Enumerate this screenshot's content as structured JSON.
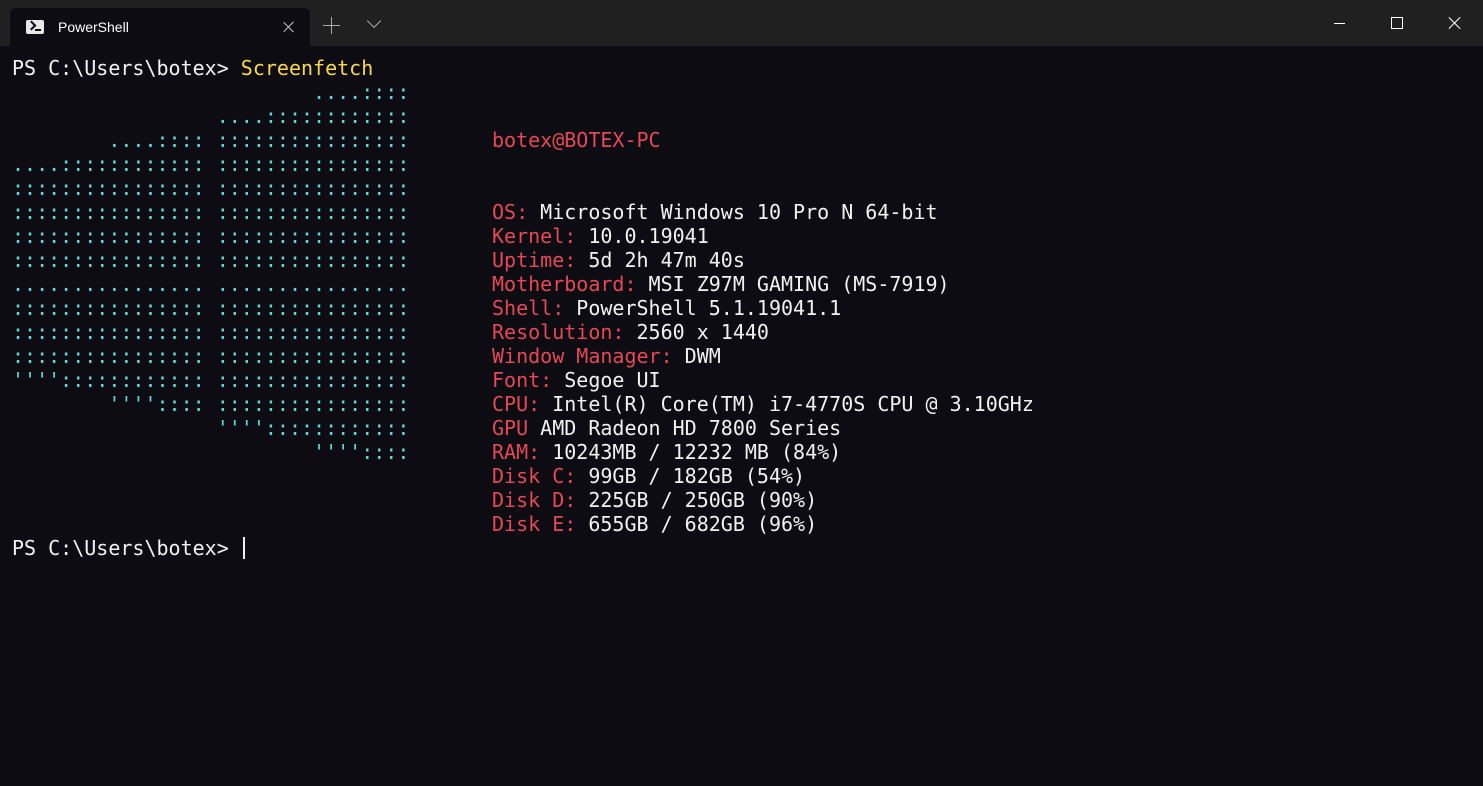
{
  "window": {
    "tab_title": "PowerShell",
    "icons": {
      "tab": "powershell-icon",
      "close_tab": "close-icon",
      "new_tab": "plus-icon",
      "dropdown": "chevron-down-icon",
      "minimize": "minimize-icon",
      "maximize": "maximize-icon",
      "close": "close-icon"
    }
  },
  "terminal": {
    "prompt": "PS C:\\Users\\botex> ",
    "command": "Screenfetch",
    "prompt2": "PS C:\\Users\\botex> ",
    "logo": [
      "                         ....::::",
      "                 ....::::::::::::",
      "        ....:::: ::::::::::::::::",
      "....:::::::::::: ::::::::::::::::",
      ":::::::::::::::: ::::::::::::::::",
      ":::::::::::::::: ::::::::::::::::",
      ":::::::::::::::: ::::::::::::::::",
      ":::::::::::::::: ::::::::::::::::",
      "................ ................",
      ":::::::::::::::: ::::::::::::::::",
      ":::::::::::::::: ::::::::::::::::",
      ":::::::::::::::: ::::::::::::::::",
      "'''':::::::::::: ::::::::::::::::",
      "        '''':::: ::::::::::::::::",
      "                 ''''::::::::::::",
      "                         ''''::::"
    ],
    "user_host": "botex@BOTEX-PC",
    "info": [
      {
        "key": "OS: ",
        "value": "Microsoft Windows 10 Pro N 64-bit"
      },
      {
        "key": "Kernel: ",
        "value": "10.0.19041"
      },
      {
        "key": "Uptime: ",
        "value": "5d 2h 47m 40s"
      },
      {
        "key": "Motherboard: ",
        "value": "MSI Z97M GAMING (MS-7919)"
      },
      {
        "key": "Shell: ",
        "value": "PowerShell 5.1.19041.1"
      },
      {
        "key": "Resolution: ",
        "value": "2560 x 1440"
      },
      {
        "key": "Window Manager: ",
        "value": "DWM"
      },
      {
        "key": "Font: ",
        "value": "Segoe UI"
      },
      {
        "key": "CPU: ",
        "value": "Intel(R) Core(TM) i7-4770S CPU @ 3.10GHz"
      },
      {
        "key": "GPU ",
        "value": "AMD Radeon HD 7800 Series"
      },
      {
        "key": "RAM: ",
        "value": "10243MB / 12232 MB (84%)"
      },
      {
        "key": "Disk C: ",
        "value": "99GB / 182GB (54%)"
      },
      {
        "key": "Disk D: ",
        "value": "225GB / 250GB (90%)"
      },
      {
        "key": "Disk E: ",
        "value": "655GB / 682GB (96%)"
      }
    ],
    "colors": {
      "background": "#0c0c12",
      "text": "#f2f2f2",
      "command": "#f9d84a",
      "logo": "#61d6d6",
      "label": "#e74856"
    }
  }
}
